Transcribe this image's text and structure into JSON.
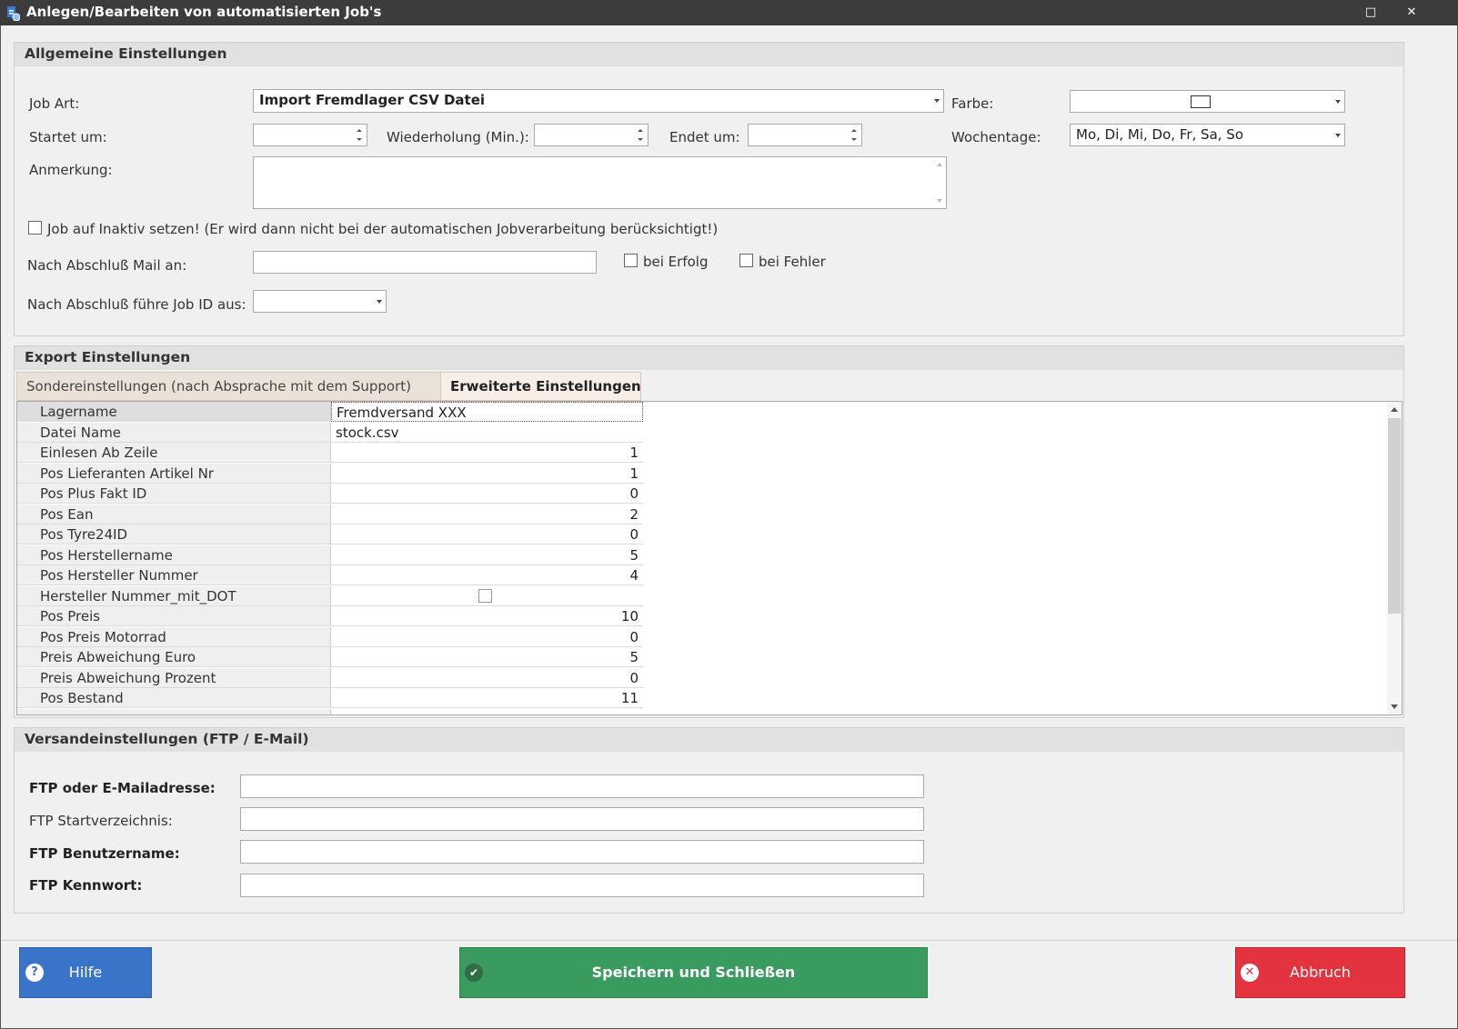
{
  "window": {
    "title": "Anlegen/Bearbeiten von automatisierten Job's",
    "icon": "app-icon",
    "controls": {
      "maximize": "□",
      "close": "✕"
    }
  },
  "general": {
    "header": "Allgemeine Einstellungen",
    "job_art_label": "Job Art:",
    "job_art_value": "Import Fremdlager CSV Datei",
    "farbe_label": "Farbe:",
    "startet_label": "Startet um:",
    "startet_value": "",
    "wiederholung_label": "Wiederholung (Min.):",
    "wiederholung_value": "",
    "endet_label": "Endet um:",
    "endet_value": "",
    "wochentage_label": "Wochentage:",
    "wochentage_value": "Mo, Di, Mi, Do, Fr, Sa, So",
    "anmerkung_label": "Anmerkung:",
    "anmerkung_value": "",
    "inaktiv_label": "Job auf Inaktiv setzen! (Er wird dann nicht bei der automatischen Jobverarbeitung berücksichtigt!)",
    "inaktiv_checked": false,
    "mail_label": "Nach Abschluß Mail an:",
    "mail_value": "",
    "erfolg_label": "bei Erfolg",
    "erfolg_checked": false,
    "fehler_label": "bei Fehler",
    "fehler_checked": false,
    "job_id_label": "Nach Abschluß führe Job ID aus:",
    "job_id_value": ""
  },
  "export": {
    "header": "Export Einstellungen",
    "tabs": [
      {
        "label": "Sondereinstellungen (nach Absprache mit dem Support)",
        "active": false
      },
      {
        "label": "Erweiterte Einstellungen",
        "active": true
      }
    ],
    "rows": [
      {
        "name": "Lagername",
        "value": "Fremdversand XXX",
        "type": "text"
      },
      {
        "name": "Datei Name",
        "value": "stock.csv",
        "type": "text"
      },
      {
        "name": "Einlesen Ab Zeile",
        "value": "1",
        "type": "num"
      },
      {
        "name": "Pos Lieferanten Artikel Nr",
        "value": "1",
        "type": "num"
      },
      {
        "name": "Pos Plus Fakt ID",
        "value": "0",
        "type": "num"
      },
      {
        "name": "Pos Ean",
        "value": "2",
        "type": "num"
      },
      {
        "name": "Pos Tyre24ID",
        "value": "0",
        "type": "num"
      },
      {
        "name": "Pos Herstellername",
        "value": "5",
        "type": "num"
      },
      {
        "name": "Pos Hersteller Nummer",
        "value": "4",
        "type": "num"
      },
      {
        "name": "Hersteller Nummer_mit_DOT",
        "value": "",
        "type": "checkbox"
      },
      {
        "name": "Pos Preis",
        "value": "10",
        "type": "num"
      },
      {
        "name": "Pos Preis Motorrad",
        "value": "0",
        "type": "num"
      },
      {
        "name": "Preis Abweichung Euro",
        "value": "5",
        "type": "num"
      },
      {
        "name": "Preis Abweichung Prozent",
        "value": "0",
        "type": "num"
      },
      {
        "name": "Pos Bestand",
        "value": "11",
        "type": "num"
      }
    ]
  },
  "versand": {
    "header": "Versandeinstellungen (FTP / E-Mail)",
    "ftp_address_label": "FTP oder E-Mailadresse:",
    "ftp_address_value": "",
    "ftp_start_label": "FTP Startverzeichnis:",
    "ftp_start_value": "",
    "ftp_user_label": "FTP Benutzername:",
    "ftp_user_value": "",
    "ftp_pass_label": "FTP Kennwort:",
    "ftp_pass_value": ""
  },
  "buttons": {
    "help_label": "Hilfe",
    "help_icon": "question-icon",
    "save_label": "Speichern und Schließen",
    "save_icon": "check-icon",
    "cancel_label": "Abbruch",
    "cancel_icon": "close-icon"
  },
  "colors": {
    "help": "#3a74c8",
    "save": "#3a9b5f",
    "cancel": "#e2333f",
    "titlebar": "#3c3c3c"
  }
}
